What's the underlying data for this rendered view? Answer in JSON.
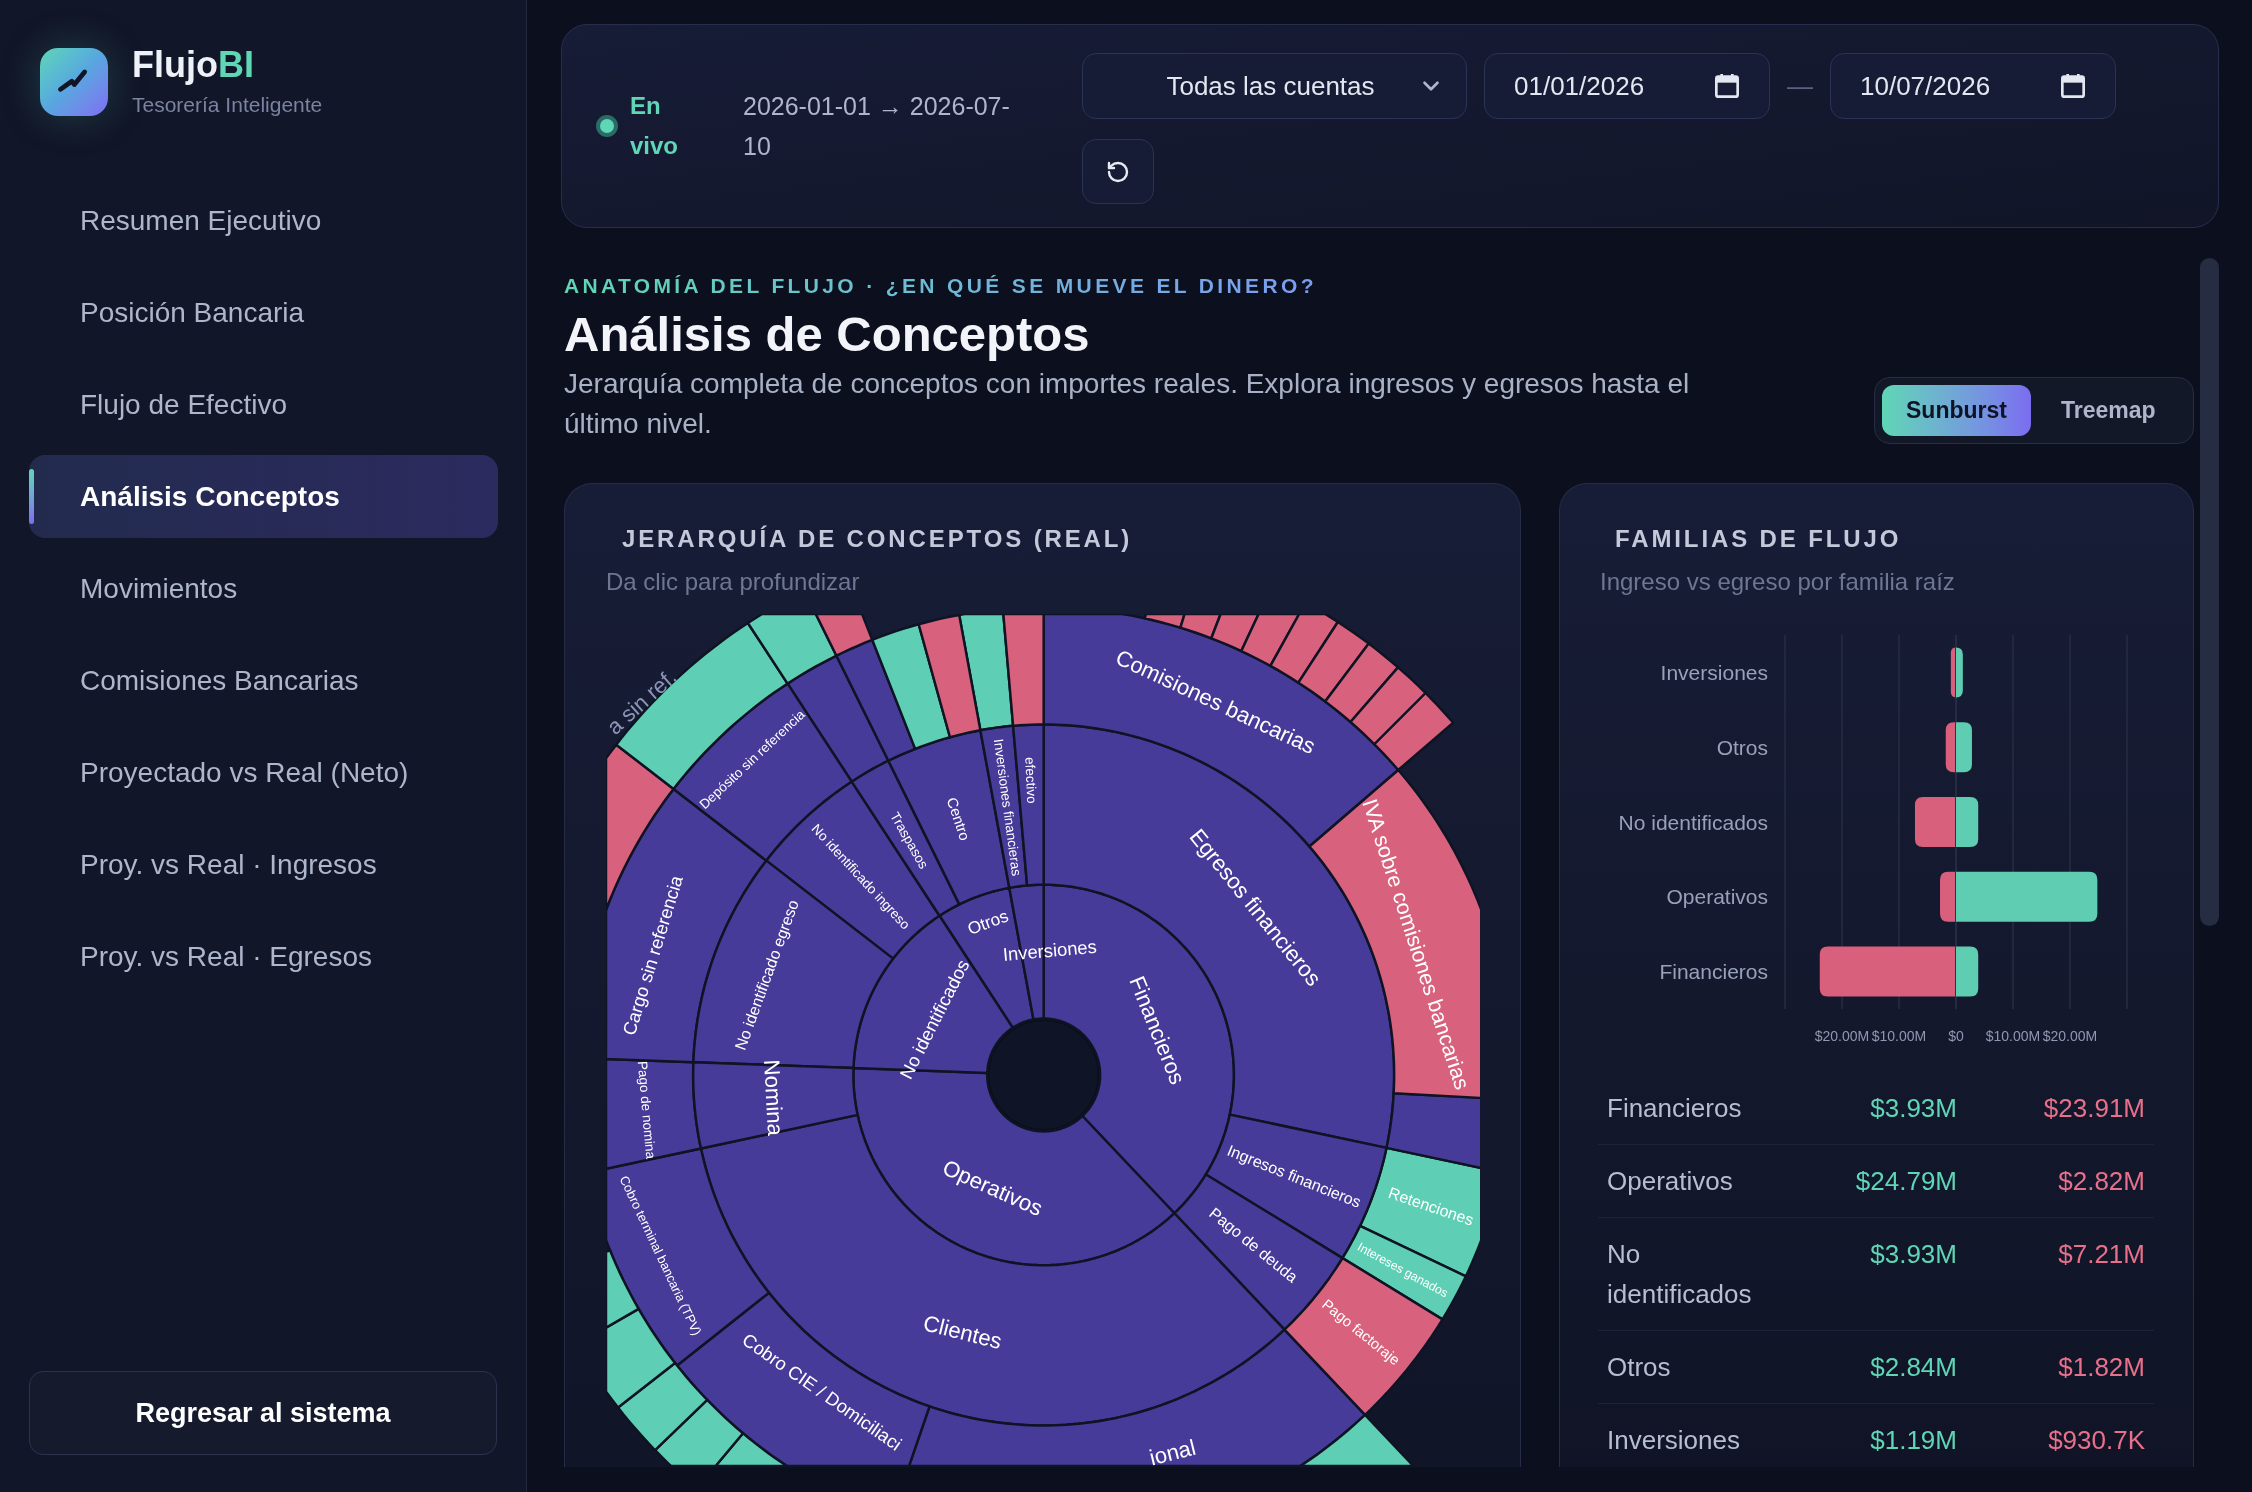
{
  "sidebar": {
    "brand": {
      "name": "Flujo",
      "accent": "BI"
    },
    "tagline": "Tesorería Inteligente",
    "items": [
      {
        "label": "Resumen Ejecutivo",
        "selected": false
      },
      {
        "label": "Posición Bancaria",
        "selected": false
      },
      {
        "label": "Flujo de Efectivo",
        "selected": false
      },
      {
        "label": "Análisis Conceptos",
        "selected": true
      },
      {
        "label": "Movimientos",
        "selected": false
      },
      {
        "label": "Comisiones Bancarias",
        "selected": false
      },
      {
        "label": "Proyectado vs Real (Neto)",
        "selected": false
      },
      {
        "label": "Proy. vs Real · Ingresos",
        "selected": false
      },
      {
        "label": "Proy. vs Real · Egresos",
        "selected": false
      }
    ],
    "footer_button": "Regresar al sistema"
  },
  "filter_bar": {
    "status": {
      "label": "En vivo",
      "live": true
    },
    "range": "2026-01-01 → 2026-07-10",
    "account_select": {
      "value": "Todas las cuentas"
    },
    "date_from": {
      "value": "01/01/2026"
    },
    "separator": "—",
    "date_to": {
      "value": "10/07/2026"
    }
  },
  "header": {
    "eyebrow": "ANATOMÍA DEL FLUJO · ¿EN QUÉ SE MUEVE EL DINERO?",
    "title": "Análisis de Conceptos",
    "description": "Jerarquía completa de conceptos con importes reales. Explora ingresos y egresos hasta el último nivel.",
    "view_toggle": [
      {
        "label": "Sunburst",
        "selected": true
      },
      {
        "label": "Treemap",
        "selected": false
      }
    ]
  },
  "hierarchy_card": {
    "title": "JERARQUÍA DE CONCEPTOS (REAL)",
    "subtitle": "Da clic para profundizar",
    "sunburst": {
      "labels": [
        "Financieros",
        "Operativos",
        "No identificados",
        "Otros",
        "Inversiones",
        "Egresos financieros",
        "Ingresos financieros",
        "Pago de deuda",
        "Clientes",
        "Nomina",
        "No identificado egreso",
        "Comisiones bancarias",
        "IVA sobre comisiones bancarias",
        "Cargo sin referencia",
        "Depósito sin referencia",
        "Pago de nomina",
        "Cobro CIE / Domiciliaci",
        "ional",
        "Pago factoraje",
        "a sin ref.",
        "Inversiones financieras",
        "Traspasos",
        "Centro",
        "Cobro terminal bancaria (TPV)",
        "No identificado ingreso",
        "efectivo",
        "Retenciones",
        "Intereses ganados"
      ]
    }
  },
  "families_card": {
    "title": "FAMILIAS DE FLUJO",
    "subtitle": "Ingreso vs egreso por familia raíz",
    "left_chart": {
      "chart_data": {
        "type": "bar",
        "orientation": "horizontal",
        "grid": true,
        "categories": [
          "Inversiones",
          "Otros",
          "No identificados",
          "Operativos",
          "Financieros"
        ],
        "series": [
          {
            "color": "#d9607c",
            "values": [
              0.9,
              1.8,
              7.2,
              2.8,
              23.9
            ]
          }
        ],
        "xlim": [
          30,
          0
        ],
        "xticks": [
          {
            "value": 20,
            "label": "$20.00M"
          },
          {
            "value": 10,
            "label": "$10.00M"
          }
        ]
      }
    },
    "right_chart": {
      "chart_data": {
        "type": "bar",
        "orientation": "horizontal",
        "grid": true,
        "series": [
          {
            "color": "#5ecdb2",
            "values": [
              1.2,
              2.8,
              3.9,
              24.8,
              3.9
            ]
          }
        ],
        "xlim": [
          0,
          30
        ],
        "xticks": [
          {
            "value": 0,
            "label": "$0"
          },
          {
            "value": 10,
            "label": "$10.00M"
          },
          {
            "value": 20,
            "label": "$20.00M"
          }
        ]
      }
    },
    "table": {
      "rows": [
        [
          "Financieros",
          "$3.93M",
          "$23.91M"
        ],
        [
          "Operativos",
          "$24.79M",
          "$2.82M"
        ],
        [
          "No identificados",
          "$3.93M",
          "$7.21M"
        ],
        [
          "Otros",
          "$2.84M",
          "$1.82M"
        ],
        [
          "Inversiones",
          "$1.19M",
          "$930.7K"
        ]
      ]
    }
  }
}
